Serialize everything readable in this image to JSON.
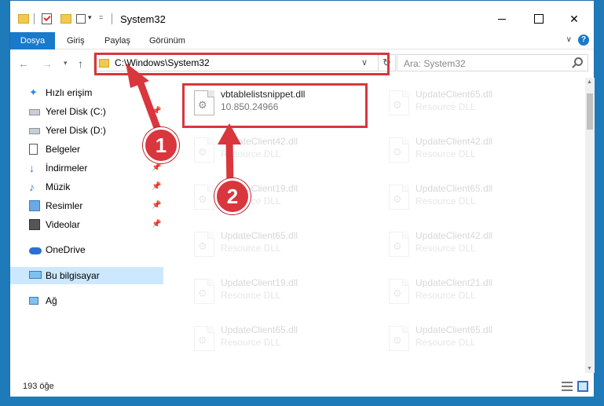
{
  "window": {
    "title": "System32",
    "minimize_icon": "minimize-icon",
    "maximize_icon": "maximize-icon",
    "close_icon": "close-icon"
  },
  "ribbon": {
    "tabs": [
      {
        "label": "Dosya"
      },
      {
        "label": "Giriş"
      },
      {
        "label": "Paylaş"
      },
      {
        "label": "Görünüm"
      }
    ],
    "expand_label": "∨",
    "help_label": "?"
  },
  "nav": {
    "address": "C:\\Windows\\System32",
    "search_placeholder": "Ara: System32"
  },
  "sidebar": {
    "items": [
      {
        "label": "Hızlı erişim",
        "icon": "star-icon",
        "pinned": false
      },
      {
        "label": "Yerel Disk (C:)",
        "icon": "disk-icon",
        "pinned": true
      },
      {
        "label": "Yerel Disk (D:)",
        "icon": "disk-icon",
        "pinned": false
      },
      {
        "label": "Belgeler",
        "icon": "documents-icon",
        "pinned": true
      },
      {
        "label": "İndirmeler",
        "icon": "downloads-icon",
        "pinned": true
      },
      {
        "label": "Müzik",
        "icon": "music-icon",
        "pinned": true
      },
      {
        "label": "Resimler",
        "icon": "pictures-icon",
        "pinned": true
      },
      {
        "label": "Videolar",
        "icon": "videos-icon",
        "pinned": true
      },
      {
        "label": "OneDrive",
        "icon": "onedrive-icon",
        "pinned": false
      },
      {
        "label": "Bu bilgisayar",
        "icon": "this-pc-icon",
        "pinned": false,
        "selected": true
      },
      {
        "label": "Ağ",
        "icon": "network-icon",
        "pinned": false
      }
    ]
  },
  "files": [
    {
      "name": "vbtablelistsnippet.dll",
      "desc": "10.850.24966",
      "highlighted": true
    },
    {
      "name": "UpdateClient65.dll",
      "desc": "Resource DLL"
    },
    {
      "name": "UpdateClient42.dll",
      "desc": "Resource DLL"
    },
    {
      "name": "UpdateClient42.dll",
      "desc": "Resource DLL"
    },
    {
      "name": "UpdateClient19.dll",
      "desc": "Resource DLL"
    },
    {
      "name": "UpdateClient65.dll",
      "desc": "Resource DLL"
    },
    {
      "name": "UpdateClient65.dll",
      "desc": "Resource DLL"
    },
    {
      "name": "UpdateClient42.dll",
      "desc": "Resource DLL"
    },
    {
      "name": "UpdateClient19.dll",
      "desc": "Resource DLL"
    },
    {
      "name": "UpdateClient21.dll",
      "desc": "Resource DLL"
    },
    {
      "name": "UpdateClient65.dll",
      "desc": "Resource DLL"
    },
    {
      "name": "UpdateClient65.dll",
      "desc": "Resource DLL"
    }
  ],
  "status": {
    "count": "193 öğe"
  },
  "annotations": {
    "step1": "1",
    "step2": "2",
    "color": "#d9363e"
  },
  "colors": {
    "accent": "#1979ca",
    "selected": "#cce8ff",
    "desktop": "#1e7ab8"
  }
}
